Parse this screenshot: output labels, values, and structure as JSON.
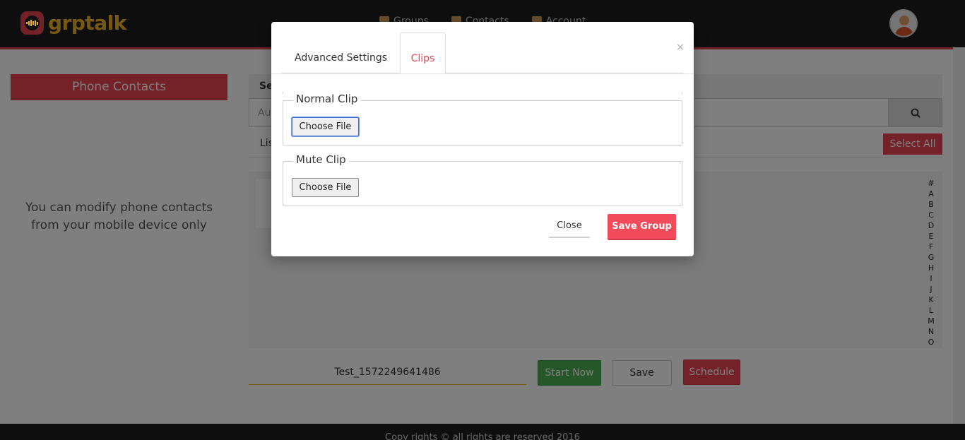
{
  "brand": {
    "name": "grptalk",
    "accent": "#e8424e",
    "logo_color": "#f0b323"
  },
  "nav": {
    "items": [
      "Groups",
      "Contacts",
      "Account"
    ]
  },
  "left_panel": {
    "title": "Phone Contacts",
    "note_line1": "You can modify phone contacts",
    "note_line2": "from your mobile device only"
  },
  "search": {
    "heading": "Se",
    "placeholder": "Au",
    "button_icon": "search-icon"
  },
  "list": {
    "label": "Lis",
    "select_all": "Select All"
  },
  "alphabet": [
    "#",
    "A",
    "B",
    "C",
    "D",
    "E",
    "F",
    "G",
    "H",
    "I",
    "J",
    "K",
    "L",
    "M",
    "N",
    "O"
  ],
  "group": {
    "name": "Test_1572249641486"
  },
  "actions": {
    "start_now": "Start Now",
    "save": "Save",
    "schedule": "Schedule"
  },
  "footer": {
    "text": "Copy rights © all rights are reserved 2016"
  },
  "modal": {
    "tabs": [
      {
        "label": "Advanced Settings",
        "active": false
      },
      {
        "label": "Clips",
        "active": true
      }
    ],
    "close_symbol": "×",
    "normal_clip": {
      "legend": "Normal Clip",
      "button": "Choose File"
    },
    "mute_clip": {
      "legend": "Mute Clip",
      "button": "Choose File"
    },
    "close_label": "Close",
    "save_group_label": "Save Group"
  }
}
